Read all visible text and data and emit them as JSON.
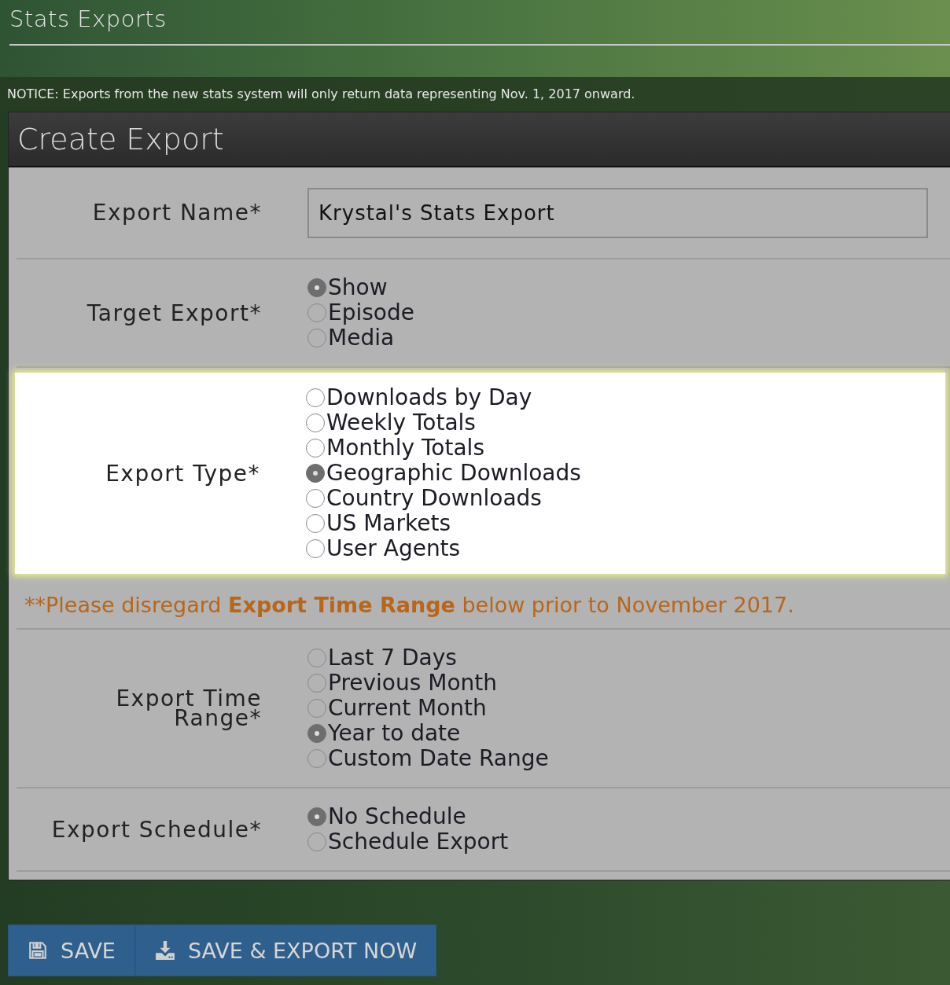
{
  "page": {
    "title": "Stats Exports"
  },
  "notice": "NOTICE: Exports from the new stats system will only return data representing Nov. 1, 2017 onward.",
  "panel": {
    "title": "Create Export",
    "rows": [
      {
        "kind": "text",
        "label": "Export Name*",
        "value": "Krystal's Stats Export",
        "highlighted": false
      },
      {
        "kind": "radio",
        "label": "Target Export*",
        "highlighted": false,
        "options": [
          {
            "label": "Show",
            "selected": true
          },
          {
            "label": "Episode",
            "selected": false
          },
          {
            "label": "Media",
            "selected": false
          }
        ]
      },
      {
        "kind": "radio",
        "label": "Export Type*",
        "highlighted": true,
        "options": [
          {
            "label": "Downloads by Day",
            "selected": false
          },
          {
            "label": "Weekly Totals",
            "selected": false
          },
          {
            "label": "Monthly Totals",
            "selected": false
          },
          {
            "label": "Geographic Downloads",
            "selected": true
          },
          {
            "label": "Country Downloads",
            "selected": false
          },
          {
            "label": "US Markets",
            "selected": false
          },
          {
            "label": "User Agents",
            "selected": false
          }
        ]
      },
      {
        "kind": "note",
        "parts": [
          {
            "text": "**Please disregard ",
            "bold": false
          },
          {
            "text": "Export Time Range",
            "bold": true
          },
          {
            "text": " below prior to November 2017.",
            "bold": false
          }
        ]
      },
      {
        "kind": "radio",
        "label": "Export Time Range*",
        "highlighted": false,
        "options": [
          {
            "label": "Last 7 Days",
            "selected": false
          },
          {
            "label": "Previous Month",
            "selected": false
          },
          {
            "label": "Current Month",
            "selected": false
          },
          {
            "label": "Year to date",
            "selected": true
          },
          {
            "label": "Custom Date Range",
            "selected": false
          }
        ]
      },
      {
        "kind": "radio",
        "label": "Export Schedule*",
        "highlighted": false,
        "options": [
          {
            "label": "No Schedule",
            "selected": true
          },
          {
            "label": "Schedule Export",
            "selected": false
          }
        ]
      }
    ]
  },
  "buttons": [
    {
      "kind": "save",
      "label": "SAVE"
    },
    {
      "kind": "export",
      "label": "SAVE & EXPORT NOW"
    }
  ]
}
